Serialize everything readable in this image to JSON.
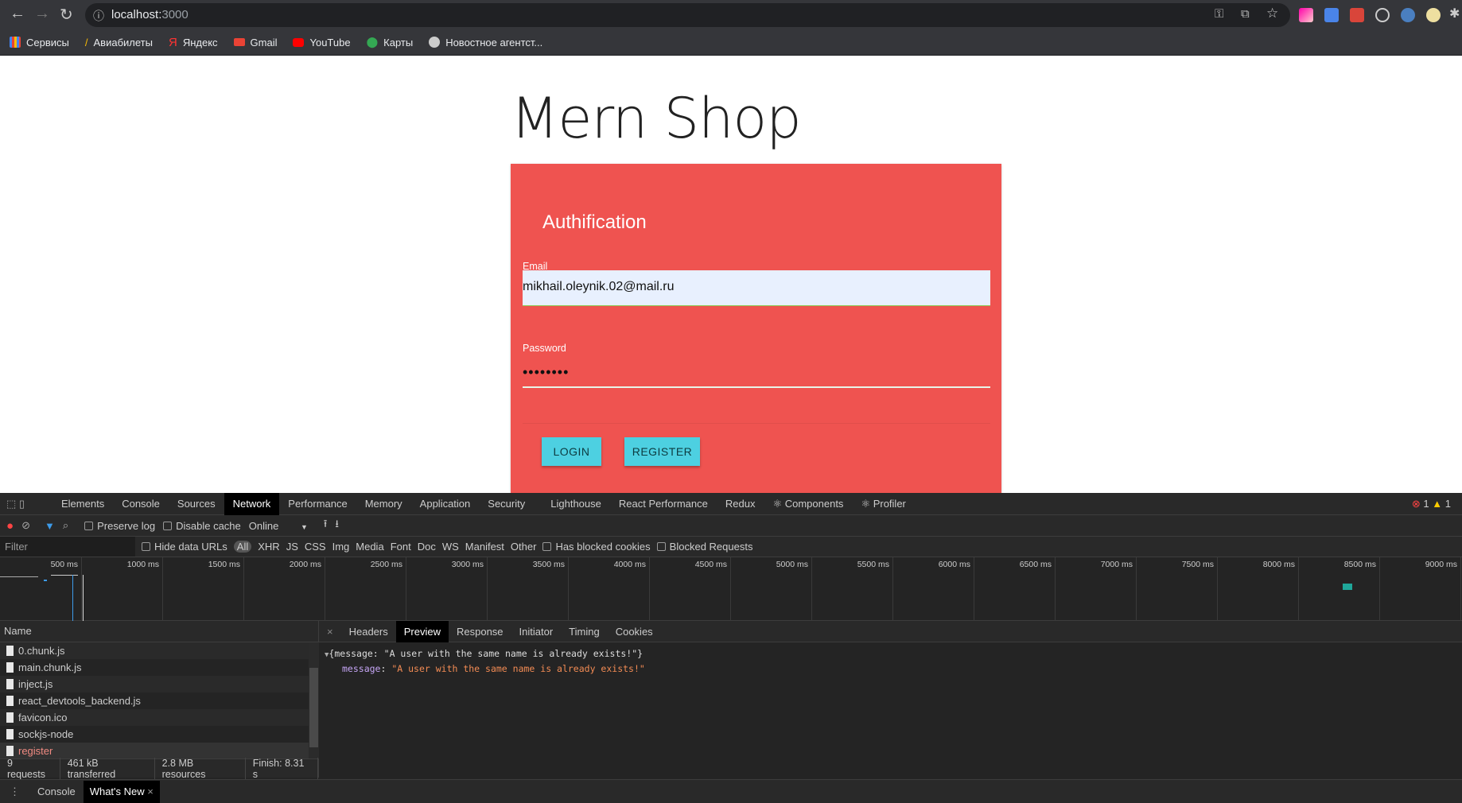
{
  "browser": {
    "url_host": "localhost:",
    "url_port": "3000",
    "bookmarks": [
      {
        "label": "Сервисы",
        "icon": "apps-grid-icon",
        "color": "#4285f4"
      },
      {
        "label": "Авиабилеты",
        "icon": "plane-icon",
        "color": "#fbbc04"
      },
      {
        "label": "Яндекс",
        "icon": "yandex-icon",
        "color": "#ff3333"
      },
      {
        "label": "Gmail",
        "icon": "gmail-icon",
        "color": "#ea4335"
      },
      {
        "label": "YouTube",
        "icon": "youtube-icon",
        "color": "#ff0000"
      },
      {
        "label": "Карты",
        "icon": "maps-pin-icon",
        "color": "#34a853"
      },
      {
        "label": "Новостное агентст...",
        "icon": "globe-icon",
        "color": "#cccccc"
      }
    ]
  },
  "page": {
    "title": "Mern Shop",
    "card_title": "Authification",
    "email_label": "Email",
    "email_value": "mikhail.oleynik.02@mail.ru",
    "password_label": "Password",
    "password_value": "••••••••",
    "login_label": "LOGIN",
    "register_label": "REGISTER",
    "accent": "#ef5350",
    "button_color": "#4dd0e1"
  },
  "devtools": {
    "tabs": [
      "Elements",
      "Console",
      "Sources",
      "Network",
      "Performance",
      "Memory",
      "Application",
      "Security",
      "Lighthouse",
      "React Performance",
      "Redux",
      "⚛ Components",
      "⚛ Profiler"
    ],
    "active_tab": "Network",
    "errors": "1",
    "warnings": "1",
    "toolbar": {
      "preserve_log": "Preserve log",
      "disable_cache": "Disable cache",
      "throttle": "Online"
    },
    "filter": {
      "placeholder": "Filter",
      "hide_data_urls": "Hide data URLs",
      "types": [
        "All",
        "XHR",
        "JS",
        "CSS",
        "Img",
        "Media",
        "Font",
        "Doc",
        "WS",
        "Manifest",
        "Other"
      ],
      "has_blocked_cookies": "Has blocked cookies",
      "blocked_requests": "Blocked Requests"
    },
    "timeline_ticks": [
      "500 ms",
      "1000 ms",
      "1500 ms",
      "2000 ms",
      "2500 ms",
      "3000 ms",
      "3500 ms",
      "4000 ms",
      "4500 ms",
      "5000 ms",
      "5500 ms",
      "6000 ms",
      "6500 ms",
      "7000 ms",
      "7500 ms",
      "8000 ms",
      "8500 ms",
      "9000 ms"
    ],
    "name_header": "Name",
    "requests": [
      "0.chunk.js",
      "main.chunk.js",
      "inject.js",
      "react_devtools_backend.js",
      "favicon.ico",
      "sockjs-node",
      "register"
    ],
    "detail_tabs": [
      "Headers",
      "Preview",
      "Response",
      "Initiator",
      "Timing",
      "Cookies"
    ],
    "active_detail_tab": "Preview",
    "preview": {
      "summary": "{message: \"A user with the same name is already exists!\"}",
      "key": "message",
      "value": "\"A user with the same name is already exists!\""
    },
    "status": {
      "requests": "9 requests",
      "transferred": "461 kB transferred",
      "resources": "2.8 MB resources",
      "finish": "Finish: 8.31 s"
    },
    "drawer": {
      "console": "Console",
      "whats_new": "What's New"
    }
  }
}
